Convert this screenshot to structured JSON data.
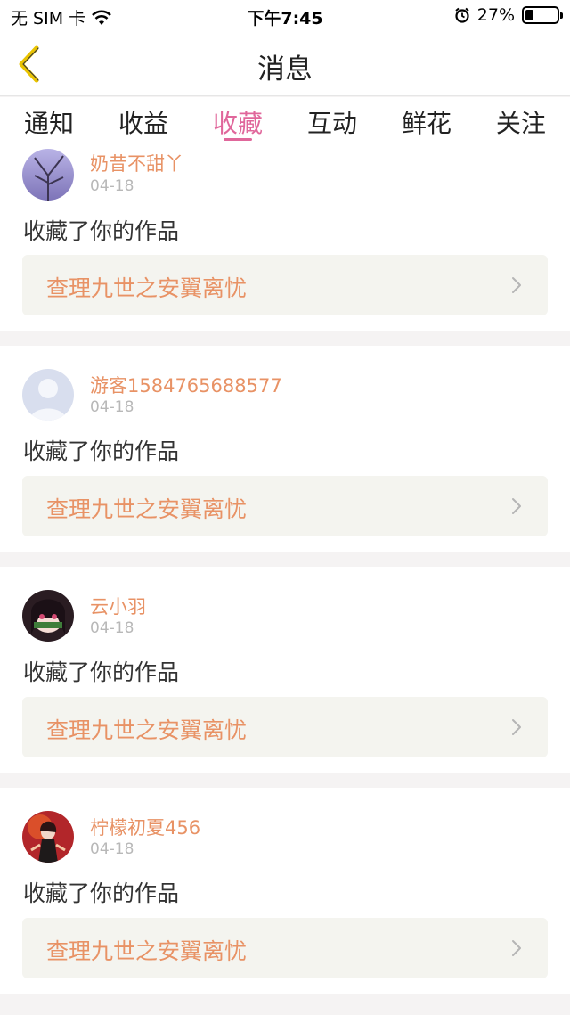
{
  "status_bar": {
    "carrier": "无 SIM 卡",
    "time": "下午7:45",
    "battery": "27%",
    "battery_level": 0.27
  },
  "header": {
    "title": "消息"
  },
  "tabs": [
    {
      "label": "通知"
    },
    {
      "label": "收益"
    },
    {
      "label": "收藏",
      "active": true
    },
    {
      "label": "互动"
    },
    {
      "label": "鲜花"
    },
    {
      "label": "关注"
    }
  ],
  "feed": [
    {
      "username": "奶昔不甜丫",
      "date": "04-18",
      "action": "收藏了你的作品",
      "work_title": "查理九世之安翼离忧"
    },
    {
      "username": "游客1584765688577",
      "date": "04-18",
      "action": "收藏了你的作品",
      "work_title": "查理九世之安翼离忧"
    },
    {
      "username": "云小羽",
      "date": "04-18",
      "action": "收藏了你的作品",
      "work_title": "查理九世之安翼离忧"
    },
    {
      "username": "柠檬初夏456",
      "date": "04-18",
      "action": "收藏了你的作品",
      "work_title": "查理九世之安翼离忧"
    }
  ],
  "colors": {
    "accent": "#e0679b",
    "username": "#e89265",
    "card_box": "#f4f4ef"
  }
}
